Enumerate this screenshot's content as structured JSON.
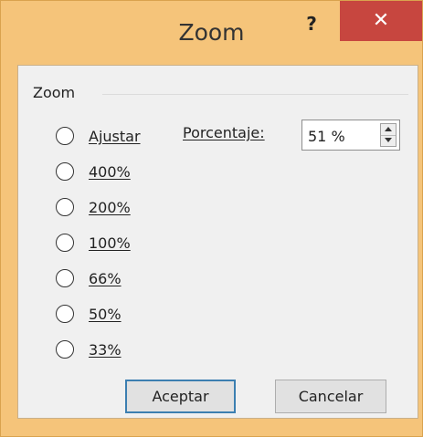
{
  "window": {
    "title": "Zoom",
    "help_label": "?",
    "close_label": "✕"
  },
  "group": {
    "label": "Zoom"
  },
  "options": [
    {
      "label": "Ajustar"
    },
    {
      "label": "400%"
    },
    {
      "label": "200%"
    },
    {
      "label": "100%"
    },
    {
      "label": "66%"
    },
    {
      "label": "50%"
    },
    {
      "label": "33%"
    }
  ],
  "percentage": {
    "label": "Porcentaje:",
    "value": "51 %"
  },
  "buttons": {
    "ok": "Aceptar",
    "cancel": "Cancelar"
  }
}
